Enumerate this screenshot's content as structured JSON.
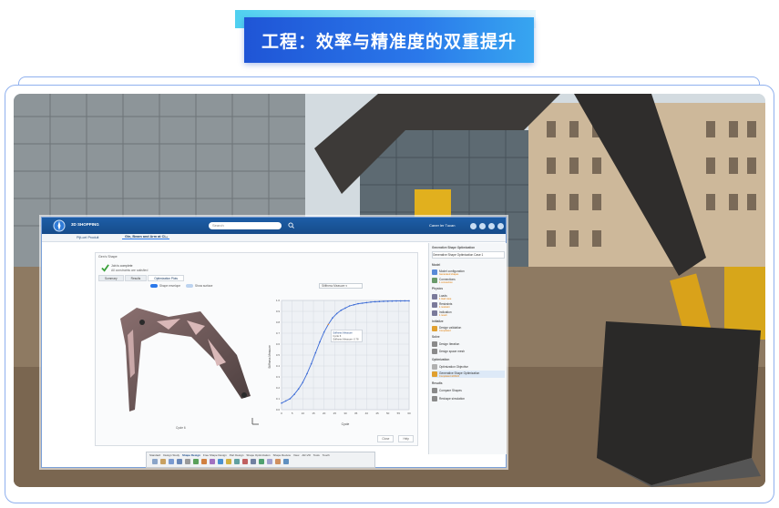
{
  "banner": {
    "title": "工程：效率与精准度的双重提升"
  },
  "app": {
    "brand": "3D SHOPPING",
    "search_placeholder": "Search",
    "user": "Caner ler Tucan",
    "breadcrumb": "Pijt-cel Produit",
    "active_tab": "Gin, Beam and Arm at CL",
    "panel": {
      "title": "Gen's Shape",
      "done_line1": "Job is complete",
      "done_line2": "All constraints are satisfied",
      "subtabs": [
        "Summary",
        "Results",
        "Optimization Plots"
      ],
      "active_subtab": "Optimization Plots",
      "toggle1": "Shape envelope",
      "toggle2": "Show surface",
      "dropdown": "Stiffness Measure",
      "shape_label": "Cycle 6",
      "buttons": [
        "Close",
        "Help"
      ]
    },
    "right_panel": {
      "title": "Generative Shape Optimization",
      "header_field": "Generative Shape Optimization Case 1",
      "model_section": "Model",
      "physics_section": "Physics",
      "initialize_section": "Initialize",
      "solve_section": "Solve",
      "optimization_section": "Optimization",
      "results_section": "Results",
      "items": [
        {
          "label": "Model configuration",
          "sub": "Generated shapes"
        },
        {
          "label": "Connections",
          "sub": "1 connection"
        },
        {
          "label": "Loads",
          "sub": "1 load case"
        },
        {
          "label": "Restraints",
          "sub": "1 restraint"
        },
        {
          "label": "Indication",
          "sub": "1 result"
        },
        {
          "label": "Design validation",
          "sub": "Completed"
        },
        {
          "label": "Design Iteration",
          "sub": ""
        },
        {
          "label": "Design space mesh",
          "sub": ""
        },
        {
          "label": "Optimization Objective",
          "sub": ""
        },
        {
          "label": "Generative Shape Optimization",
          "sub": "Completed 4/23/24"
        },
        {
          "label": "Compare Shapes",
          "sub": ""
        },
        {
          "label": "Reshape simulation",
          "sub": ""
        }
      ]
    },
    "bottom_toolbar": {
      "tabs": [
        "Standard",
        "Design Study",
        "Shape Design",
        "Free Shape Design",
        "Part Design",
        "Shape Optimization",
        "Shape Review",
        "View",
        "AR-VR",
        "Tools",
        "Touch"
      ],
      "active_tab": "Shape Design"
    }
  },
  "colors": {
    "banner_blue": "#2a78ea",
    "titlebar": "#1d5ea7",
    "chart_curve": "#3b6bd6",
    "marker": "#e38b32"
  },
  "chart_data": {
    "type": "line",
    "title": "",
    "xlabel": "Cycle",
    "ylabel": "Stiffness Measure",
    "x": [
      0,
      2,
      4,
      6,
      8,
      10,
      12,
      14,
      16,
      18,
      20,
      22,
      24,
      26,
      28,
      30,
      32,
      34,
      36,
      38,
      40,
      42,
      44,
      46,
      48,
      50,
      52,
      54,
      56,
      58,
      60
    ],
    "series": [
      {
        "values": [
          0.06,
          0.08,
          0.1,
          0.14,
          0.19,
          0.25,
          0.33,
          0.42,
          0.52,
          0.62,
          0.71,
          0.78,
          0.84,
          0.88,
          0.91,
          0.93,
          0.95,
          0.96,
          0.97,
          0.975,
          0.98,
          0.985,
          0.988,
          0.99,
          0.992,
          0.993,
          0.994,
          0.995,
          0.995,
          0.996,
          0.996
        ]
      }
    ],
    "xlim": [
      0,
      60
    ],
    "ylim": [
      0,
      1
    ],
    "grid": true,
    "annotation": {
      "x": 22,
      "lines": [
        "Stiffness Measure",
        "Cycle 6",
        "Stiffness Measure: 0.78"
      ]
    }
  }
}
